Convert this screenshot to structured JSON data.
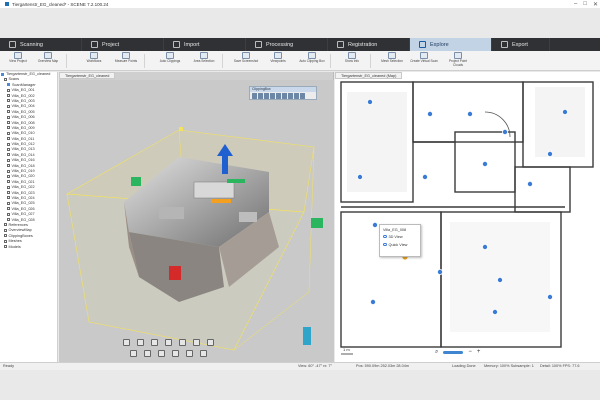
{
  "window": {
    "title": "Tiergartenstr_EG_cleaned* - SCENE 7.2.100.24",
    "controls": [
      "minimize-icon",
      "maximize-icon",
      "close-icon"
    ]
  },
  "workflow_tabs": [
    {
      "label": "Scanning",
      "active": false
    },
    {
      "label": "Project",
      "active": false
    },
    {
      "label": "Import",
      "active": false
    },
    {
      "label": "Processing",
      "active": false
    },
    {
      "label": "Registration",
      "active": false
    },
    {
      "label": "Explore",
      "active": true
    },
    {
      "label": "Export",
      "active": false
    }
  ],
  "ribbon": [
    "View Project",
    "Overview Map",
    "Workflows",
    "Measure Points",
    "Auto Clippings",
    "Area Selection",
    "Save Screenshot",
    "Viewpoints",
    "Auto Clipping Box",
    "Show Info",
    "Mesh Selection",
    "Create Virtual Scan",
    "Project Point Clouds"
  ],
  "tree": {
    "root": "Tiergartenstr_EG_cleaned",
    "scans": "Scans",
    "scanmanager": "ScanManager",
    "items": [
      "Villa_EG_001",
      "Villa_EG_002",
      "Villa_EG_003",
      "Villa_EG_004",
      "Villa_EG_005",
      "Villa_EG_006",
      "Villa_EG_008",
      "Villa_EG_009",
      "Villa_EG_010",
      "Villa_EG_011",
      "Villa_EG_012",
      "Villa_EG_013",
      "Villa_EG_014",
      "Villa_EG_016",
      "Villa_EG_018",
      "Villa_EG_019",
      "Villa_EG_020",
      "Villa_EG_021",
      "Villa_EG_022",
      "Villa_EG_023",
      "Villa_EG_024",
      "Villa_EG_025",
      "Villa_EG_026",
      "Villa_EG_027",
      "Villa_EG_028"
    ],
    "footer_items": [
      "References",
      "OverviewMap",
      "ClippingBoxes",
      "Meshes",
      "Models"
    ]
  },
  "view3d": {
    "tab_label": "Tiergartenstr_EG_cleaned",
    "clip_panel_title": "ClippingBox"
  },
  "view2d": {
    "tab_label": "Tiergartenstr_EG_cleaned (Map)",
    "popup": {
      "title": "Villa_EG_008",
      "options": [
        "3D View",
        "Quick View"
      ]
    },
    "scale": "1 m",
    "zoom_minus": "−",
    "zoom_plus": "+"
  },
  "status": {
    "left": "Ready",
    "view": "View: 60° -47° rx: 7°",
    "pos": "Pos: 590.09m 252.03m 28.04m",
    "loading": "Loading Done",
    "memory": "Memory: 100%  Subsample: 1",
    "detail": "Detail: 100%  FPS: 77.6"
  },
  "colors": {
    "workflow_bg": "#2f3134",
    "active_tab": "#c3d3e6",
    "map_marker": "#3a7bd5",
    "selected_marker": "#e8a320",
    "clip_box": "#f3e25c"
  }
}
